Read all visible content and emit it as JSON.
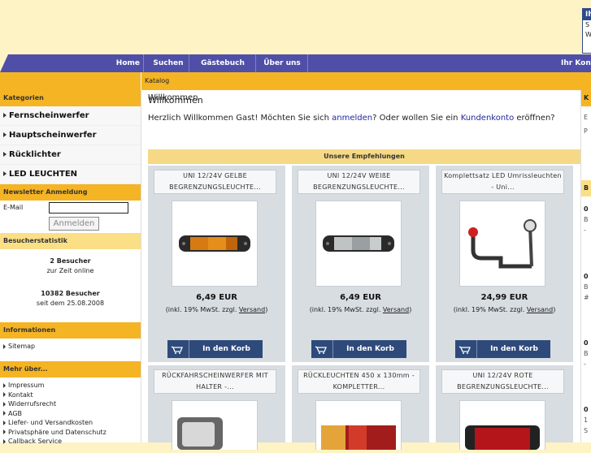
{
  "login_box": {
    "title": "Ihr",
    "line1": "S",
    "line2": "W"
  },
  "nav": {
    "home": "Home",
    "search": "Suchen",
    "guestbook": "Gästebuch",
    "about": "Über uns",
    "account": "Ihr Kon"
  },
  "breadcrumb": "Katalog",
  "categories": {
    "header": "Kategorien",
    "items": [
      "Fernscheinwerfer",
      "Hauptscheinwerfer",
      "Rücklichter",
      "LED LEUCHTEN"
    ]
  },
  "newsletter": {
    "header": "Newsletter Anmeldung",
    "email_label": "E-Mail",
    "email_value": "",
    "button": "Anmelden"
  },
  "visitors": {
    "header": "Besucherstatistik",
    "online_count": "2 Besucher",
    "online_text": "zur Zeit online",
    "total_count": "10382 Besucher",
    "since_text": "seit dem 25.08.2008"
  },
  "information": {
    "header": "Informationen",
    "items": [
      "Sitemap"
    ]
  },
  "more_about": {
    "header": "Mehr über...",
    "items": [
      "Impressum",
      "Kontakt",
      "Widerrufsrecht",
      "AGB",
      "Liefer- und Versandkosten",
      "Privatsphäre und Datenschutz",
      "Callback Service"
    ]
  },
  "welcome": {
    "title": "Willkommen",
    "text_1": "Herzlich Willkommen Gast! Möchten Sie sich ",
    "link_login": "anmelden",
    "text_2": "? Oder wollen Sie ein ",
    "link_account": "Kundenkonto",
    "text_3": " eröffnen?"
  },
  "recommendations": {
    "header": "Unsere Empfehlungen",
    "tax_prefix": "(inkl. 19% MwSt. zzgl. ",
    "tax_link": "Versand",
    "tax_suffix": ")",
    "cart_label": "In den Korb",
    "products": [
      {
        "name": "UNI 12/24V GELBE BEGRENZUNGSLEUCHTE...",
        "price": "6,49 EUR",
        "image": "amber-marker-light"
      },
      {
        "name": "UNI 12/24V WEIßE BEGRENZUNGSLEUCHTE...",
        "price": "6,49 EUR",
        "image": "white-marker-light"
      },
      {
        "name": "Komplettsatz LED Umrissleuchten - Uni...",
        "price": "24,99 EUR",
        "image": "outline-light-set"
      },
      {
        "name": "RÜCKFAHRSCHEINWERFER MIT HALTER -...",
        "image": "reversing-light"
      },
      {
        "name": "RÜCKLEUCHTEN 450 x 130mm - KOMPLETTER...",
        "image": "rear-light"
      },
      {
        "name": "UNI 12/24V ROTE BEGRENZUNGSLEUCHTE...",
        "image": "red-marker-light"
      }
    ]
  },
  "right_column": {
    "header1": "K",
    "line_e": "E",
    "line_p": "P",
    "header2": "B",
    "f1": "0",
    "f2": "B",
    "f3": "-",
    "f4": "0",
    "f5": "B",
    "f6": "#",
    "f7": "0",
    "f8": "B",
    "f9": "-",
    "f10": "0",
    "f11": "1",
    "f12": "S"
  },
  "colors": {
    "page_bg": "#fdf3c4",
    "nav": "#4f4fa8",
    "accent": "#f5b423",
    "link": "#22269a",
    "button": "#2e4a7a"
  }
}
